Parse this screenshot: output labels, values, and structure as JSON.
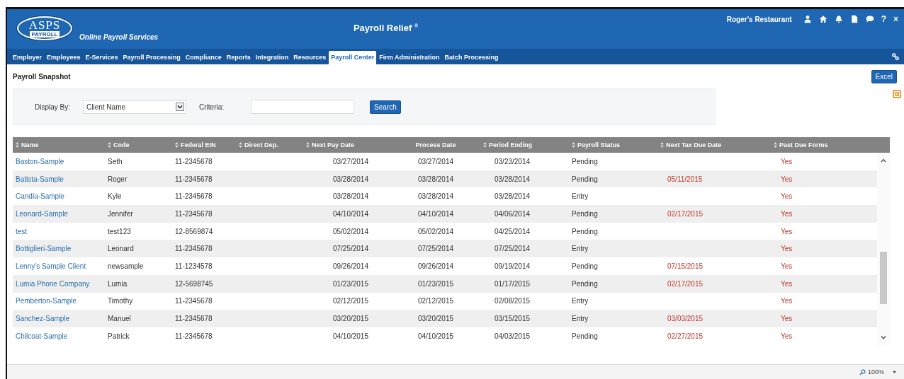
{
  "header": {
    "logo": {
      "big": "ASPS",
      "small": "PAYROLL"
    },
    "tagline": "Online Payroll Services",
    "title": "Payroll Relief",
    "title_mark": "®",
    "account": "Roger's Restaurant",
    "help": "?",
    "close": "×"
  },
  "nav": [
    {
      "label": "Employer",
      "selected": false
    },
    {
      "label": "Employees",
      "selected": false
    },
    {
      "label": "E-Services",
      "selected": false
    },
    {
      "label": "Payroll Processing",
      "selected": false
    },
    {
      "label": "Compliance",
      "selected": false
    },
    {
      "label": "Reports",
      "selected": false
    },
    {
      "label": "Integration",
      "selected": false
    },
    {
      "label": "Resources",
      "selected": false
    },
    {
      "label": "Payroll Center",
      "selected": true
    },
    {
      "label": "Firm Administration",
      "selected": false
    },
    {
      "label": "Batch Processing",
      "selected": false
    }
  ],
  "page_title": "Payroll Snapshot",
  "excel_button": "Excel",
  "filter": {
    "display_label": "Display By:",
    "display_value": "Client Name",
    "criteria_label": "Criteria:",
    "search_button": "Search"
  },
  "table": {
    "columns": [
      {
        "label": "Name",
        "sortable": true,
        "kind": "link"
      },
      {
        "label": "Code",
        "sortable": true,
        "kind": "text"
      },
      {
        "label": "Federal EIN",
        "sortable": true,
        "kind": "text"
      },
      {
        "label": "Direct Dep.",
        "sortable": true,
        "kind": "text"
      },
      {
        "label": "Next Pay Date",
        "sortable": true,
        "kind": "right"
      },
      {
        "label": "Process Date",
        "sortable": false,
        "kind": "center"
      },
      {
        "label": "Period Ending",
        "sortable": true,
        "kind": "text"
      },
      {
        "label": "Payroll Status",
        "sortable": true,
        "kind": "text"
      },
      {
        "label": "Next Tax Due Date",
        "sortable": true,
        "kind": "alert"
      },
      {
        "label": "Past Due Forms",
        "sortable": true,
        "kind": "alert"
      }
    ],
    "rows": [
      [
        "Baston-Sample",
        "Seth",
        "11-2345678",
        "",
        "03/27/2014",
        "03/27/2014",
        "03/23/2014",
        "Pending",
        "",
        "Yes"
      ],
      [
        "Batista-Sample",
        "Roger",
        "11-2345678",
        "",
        "03/28/2014",
        "03/28/2014",
        "03/28/2014",
        "Pending",
        "05/11/2015",
        "Yes"
      ],
      [
        "Candia-Sample",
        "Kyle",
        "11-2345678",
        "",
        "03/28/2014",
        "03/28/2014",
        "03/28/2014",
        "Entry",
        "",
        "Yes"
      ],
      [
        "Leonard-Sample",
        "Jennifer",
        "11-2345678",
        "",
        "04/10/2014",
        "04/10/2014",
        "04/06/2014",
        "Pending",
        "02/17/2015",
        "Yes"
      ],
      [
        "test",
        "test123",
        "12-8569874",
        "",
        "05/02/2014",
        "05/02/2014",
        "04/25/2014",
        "Pending",
        "",
        "Yes"
      ],
      [
        "Bottiglieri-Sample",
        "Leonard",
        "11-2345678",
        "",
        "07/25/2014",
        "07/25/2014",
        "07/25/2014",
        "Entry",
        "",
        "Yes"
      ],
      [
        "Lenny's Sample Client",
        "newsample",
        "11-1234578",
        "",
        "09/26/2014",
        "09/26/2014",
        "09/19/2014",
        "Pending",
        "07/15/2015",
        "Yes"
      ],
      [
        "Lumia Phone Company",
        "Lumia",
        "12-5698745",
        "",
        "01/23/2015",
        "01/23/2015",
        "01/17/2015",
        "Pending",
        "02/17/2015",
        "Yes"
      ],
      [
        "Pemberton-Sample",
        "Timothy",
        "11-2345678",
        "",
        "02/12/2015",
        "02/12/2015",
        "02/08/2015",
        "Entry",
        "",
        "Yes"
      ],
      [
        "Sanchez-Sample",
        "Manuel",
        "11-2345678",
        "",
        "03/20/2015",
        "03/20/2015",
        "03/15/2015",
        "Entry",
        "03/03/2015",
        "Yes"
      ],
      [
        "Chilcoat-Sample",
        "Patrick",
        "11-2345678",
        "",
        "04/10/2015",
        "04/10/2015",
        "04/03/2015",
        "Pending",
        "02/27/2015",
        "Yes"
      ]
    ]
  },
  "status_bar": {
    "zoom": "100%"
  }
}
